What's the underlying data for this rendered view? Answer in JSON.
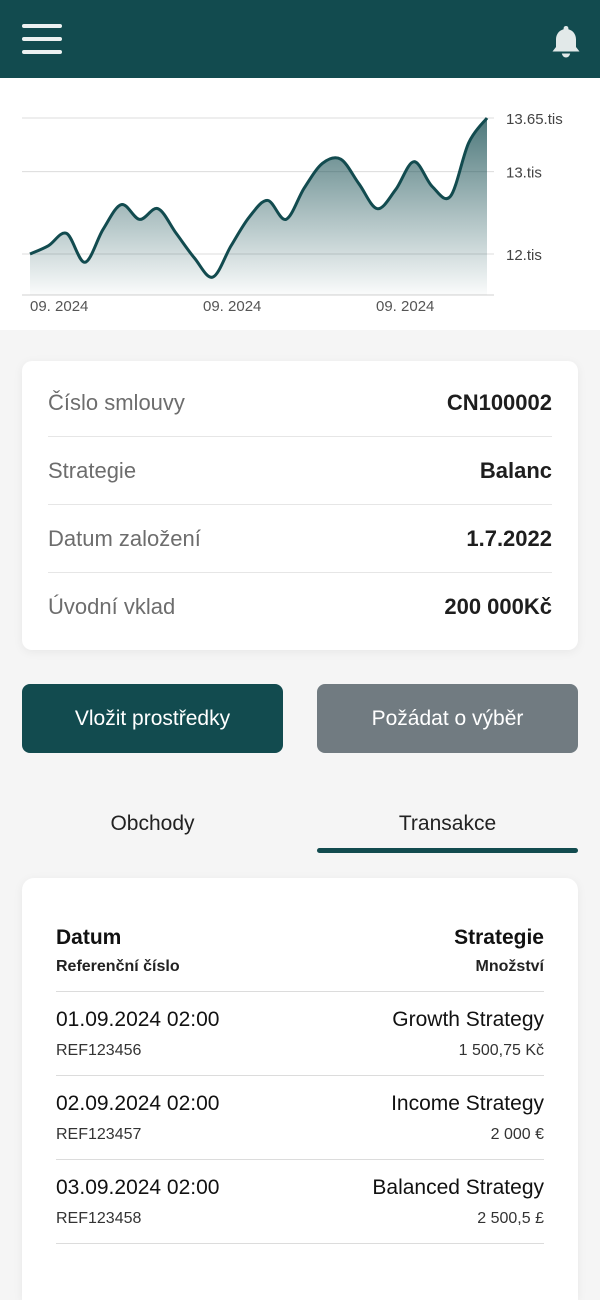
{
  "header": {
    "menu_icon": "hamburger-menu-icon",
    "bell_icon": "bell-icon",
    "bg_color": "#124b4f"
  },
  "chart_data": {
    "type": "area",
    "x_ticks": [
      "09. 2024",
      "09. 2024",
      "09. 2024"
    ],
    "y_ticks": [
      {
        "value": 12.0,
        "label": "12.tis"
      },
      {
        "value": 13.0,
        "label": "13.tis"
      },
      {
        "value": 13.65,
        "label": "13.65.tis"
      }
    ],
    "ylim": [
      11.6,
      13.65
    ],
    "series": [
      {
        "values": [
          12.0,
          12.1,
          12.25,
          11.9,
          12.3,
          12.6,
          12.42,
          12.55,
          12.25,
          11.95,
          11.72,
          12.1,
          12.45,
          12.65,
          12.42,
          12.8,
          13.1,
          13.15,
          12.85,
          12.55,
          12.78,
          13.12,
          12.82,
          12.7,
          13.35,
          13.65
        ]
      }
    ],
    "line_color": "#124b4f",
    "grid": true
  },
  "contract": {
    "rows": [
      {
        "label": "Číslo smlouvy",
        "value": "CN100002"
      },
      {
        "label": "Strategie",
        "value": "Balanc"
      },
      {
        "label": "Datum založení",
        "value": "1.7.2022"
      },
      {
        "label": "Úvodní vklad",
        "value": "200 000Kč"
      }
    ]
  },
  "actions": {
    "deposit_label": "Vložit prostředky",
    "withdraw_label": "Požádat o výběr"
  },
  "tabs": [
    {
      "label": "Obchody",
      "active": false
    },
    {
      "label": "Transakce",
      "active": true
    }
  ],
  "transactions": {
    "headers": {
      "date": "Datum",
      "reference": "Referenční číslo",
      "strategy": "Strategie",
      "amount": "Množství"
    },
    "rows": [
      {
        "date": "01.09.2024 02:00",
        "reference": "REF123456",
        "strategy": "Growth Strategy",
        "amount": "1 500,75 Kč"
      },
      {
        "date": "02.09.2024 02:00",
        "reference": "REF123457",
        "strategy": "Income Strategy",
        "amount": "2 000 €"
      },
      {
        "date": "03.09.2024 02:00",
        "reference": "REF123458",
        "strategy": "Balanced Strategy",
        "amount": "2 500,5 £"
      }
    ]
  }
}
